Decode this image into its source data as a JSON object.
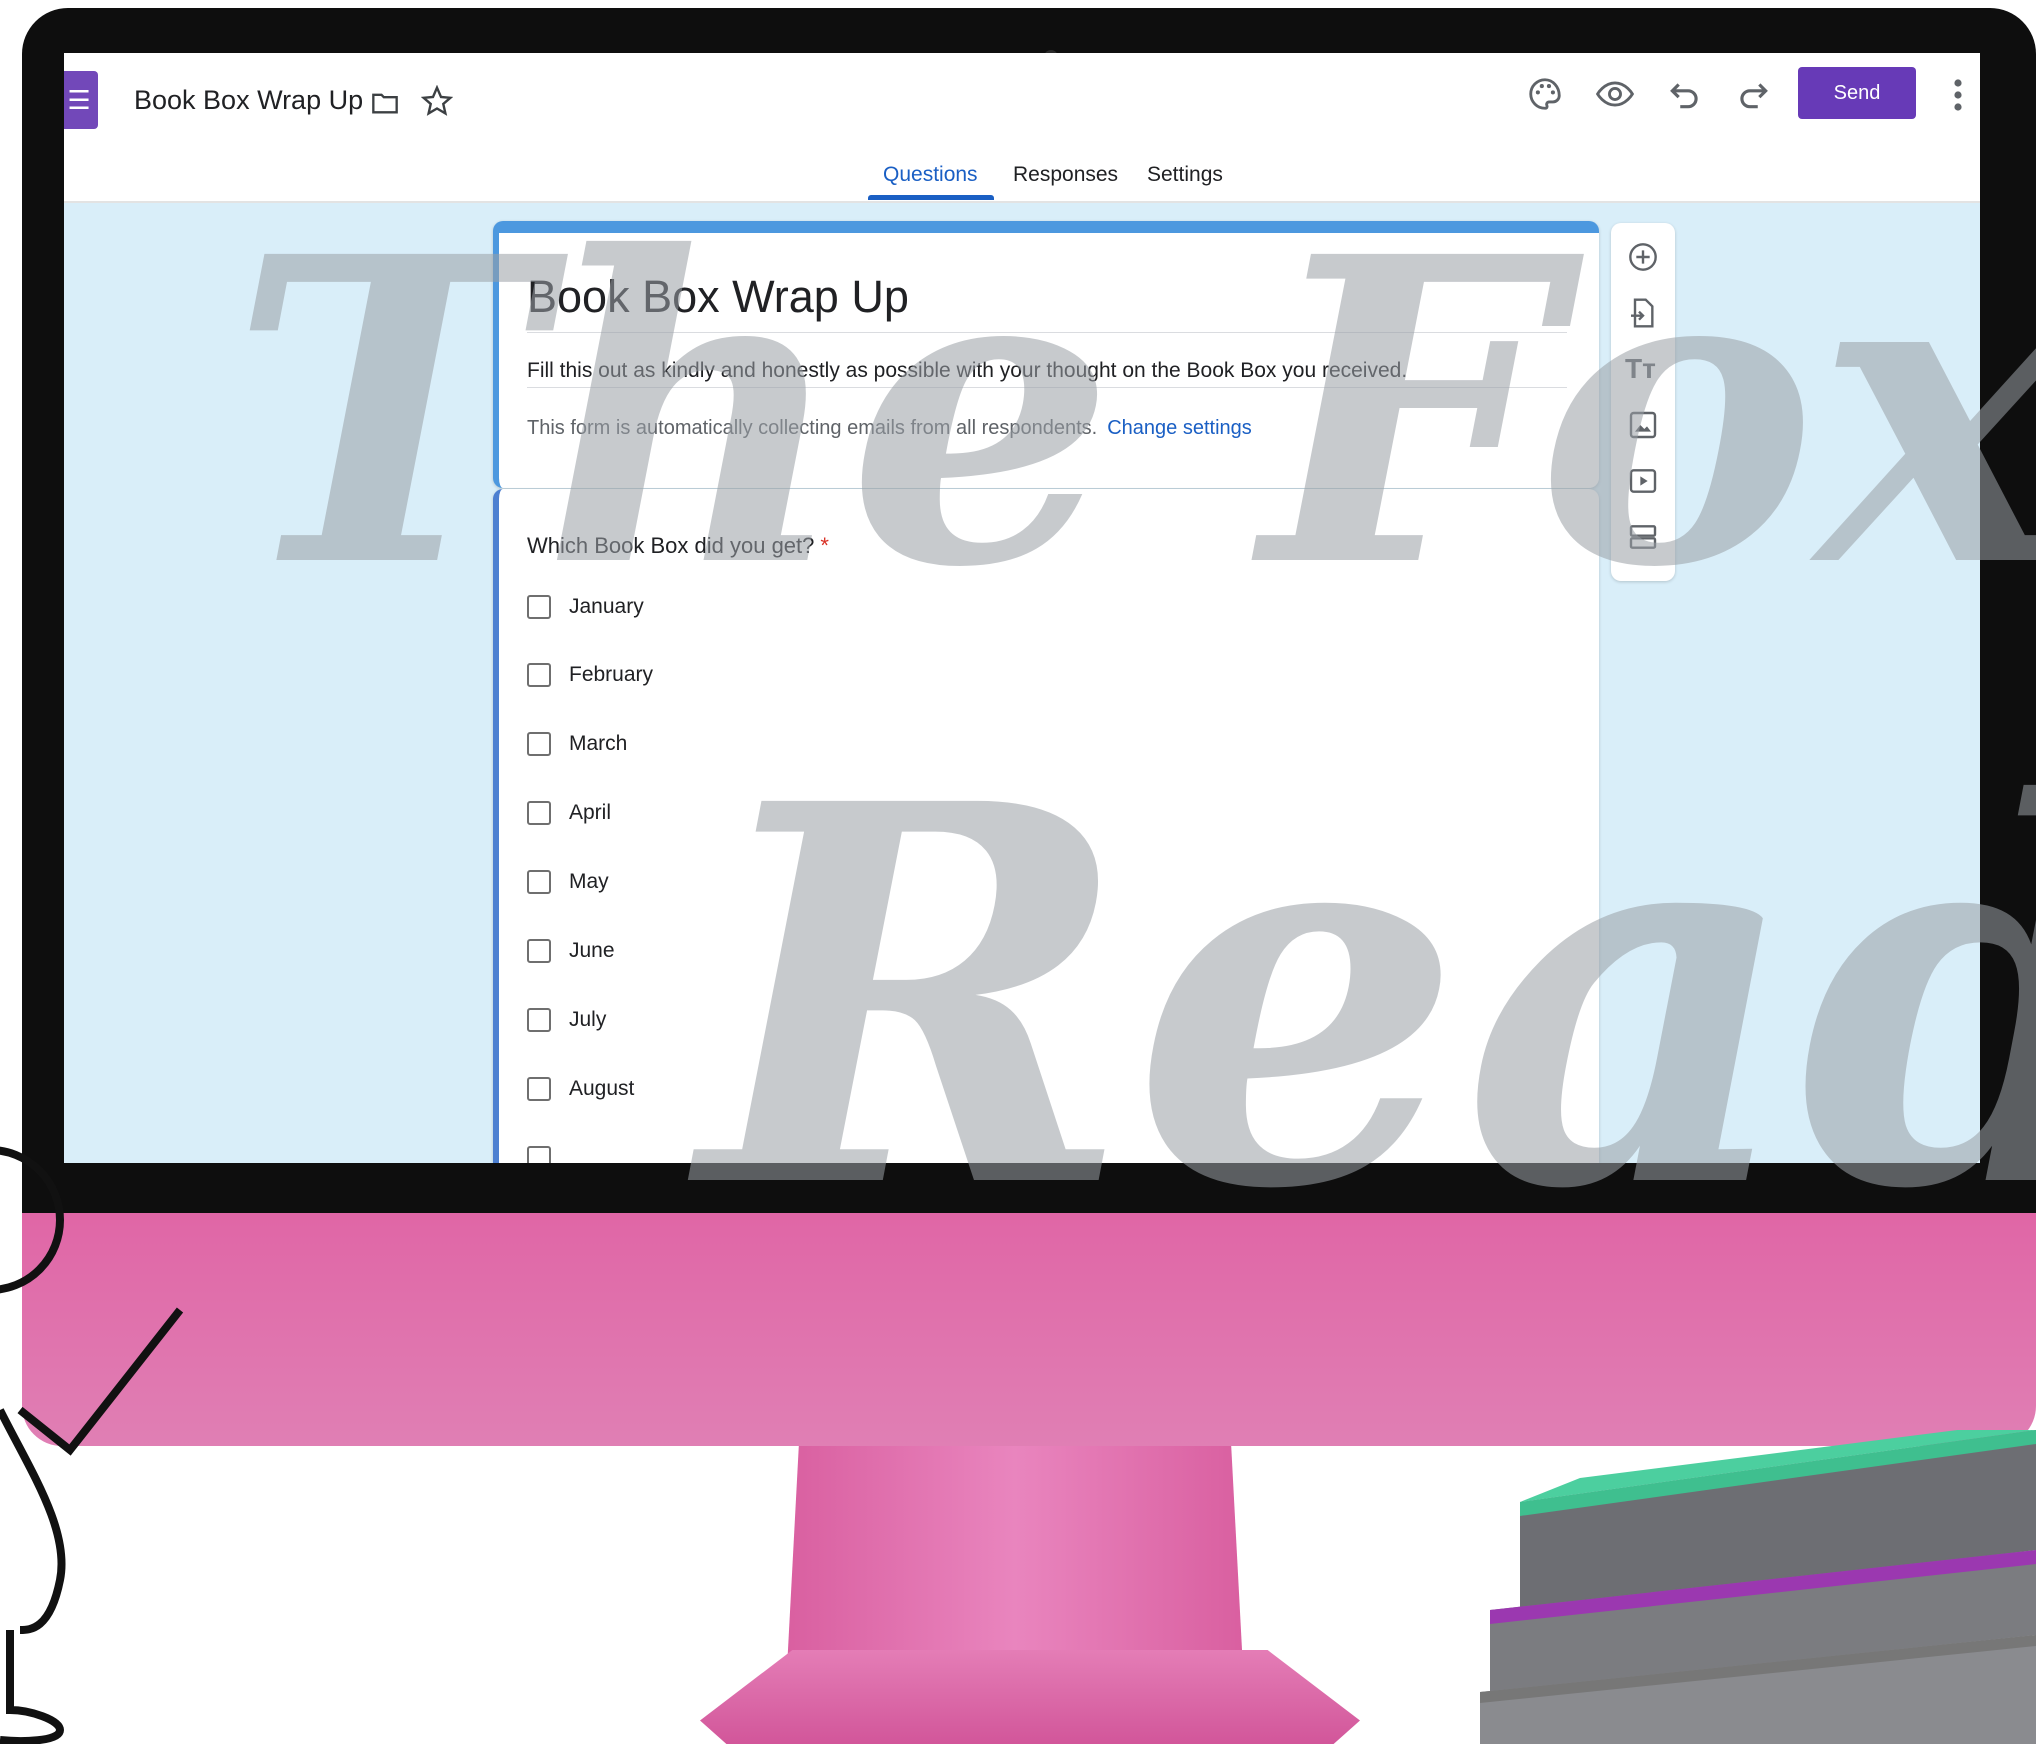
{
  "app": {
    "doc_title": "Book Box Wrap Up",
    "send_label": "Send"
  },
  "tabs": [
    {
      "label": "Questions",
      "active": true
    },
    {
      "label": "Responses",
      "active": false
    },
    {
      "label": "Settings",
      "active": false
    }
  ],
  "form": {
    "title": "Book Box Wrap Up",
    "description": "Fill this out as kindly and honestly as possible with  your thought on the Book Box you received.",
    "email_note": "This form is automatically collecting emails from all respondents.",
    "change_settings_link": "Change settings"
  },
  "question": {
    "text": "Which Book Box did you get?",
    "required_mark": "*",
    "options": [
      "January",
      "February",
      "March",
      "April",
      "May",
      "June",
      "July",
      "August"
    ]
  },
  "watermark": {
    "line1": "The Fox",
    "line2": "Reads"
  },
  "icons": {
    "toolbar": [
      "palette-icon",
      "preview-eye-icon",
      "undo-icon",
      "redo-icon",
      "more-vert-icon"
    ],
    "side": [
      "add-question-icon",
      "import-questions-icon",
      "add-title-icon",
      "add-image-icon",
      "add-video-icon",
      "add-section-icon"
    ]
  },
  "colors": {
    "brand_purple": "#673ab7",
    "accent_blue": "#1a5fc4",
    "form_background": "#d9eef9",
    "monitor_pink": "#e066a6",
    "required_red": "#d93025"
  }
}
